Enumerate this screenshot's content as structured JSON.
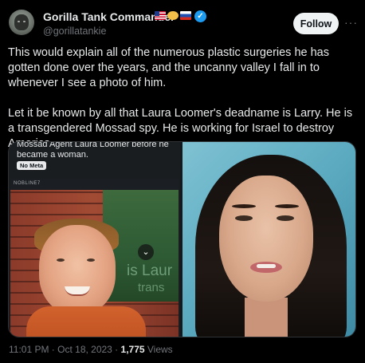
{
  "author": {
    "display_name": "Gorilla Tank Commander",
    "handle": "@gorillatankie",
    "flag_icons": [
      "us-flag-icon",
      "heart-hands-icon",
      "russia-flag-icon"
    ],
    "verified_icon": "verified-badge-icon",
    "verified_glyph": "✓"
  },
  "actions": {
    "follow_label": "Follow",
    "more_glyph": "···"
  },
  "tweet": {
    "paragraphs": [
      "This would explain all of the numerous plastic surgeries he has gotten done over the years, and the uncanny valley I fall in to whenever I see a photo of him.",
      "Let it be known by all that Laura Loomer's deadname is Larry. He is a transgendered Mossad spy. He is working for Israel to destroy America."
    ]
  },
  "media": {
    "caption": "Mossad Agent Laura Loomer before he became a woman.",
    "badge": "No Meta",
    "photo_corner_text": "NOBLINE7",
    "overlay_line_1": "is Laur",
    "overlay_line_2": "trans",
    "chevron_glyph": "⌄"
  },
  "meta": {
    "timestamp": "11:01 PM · Oct 18, 2023 · ",
    "views_count": "1,775",
    "views_label": " Views"
  },
  "colors": {
    "background": "#000000",
    "text": "#e7e9ea",
    "muted": "#71767b",
    "verified": "#1d9bf0",
    "follow_bg": "#eff3f4"
  }
}
